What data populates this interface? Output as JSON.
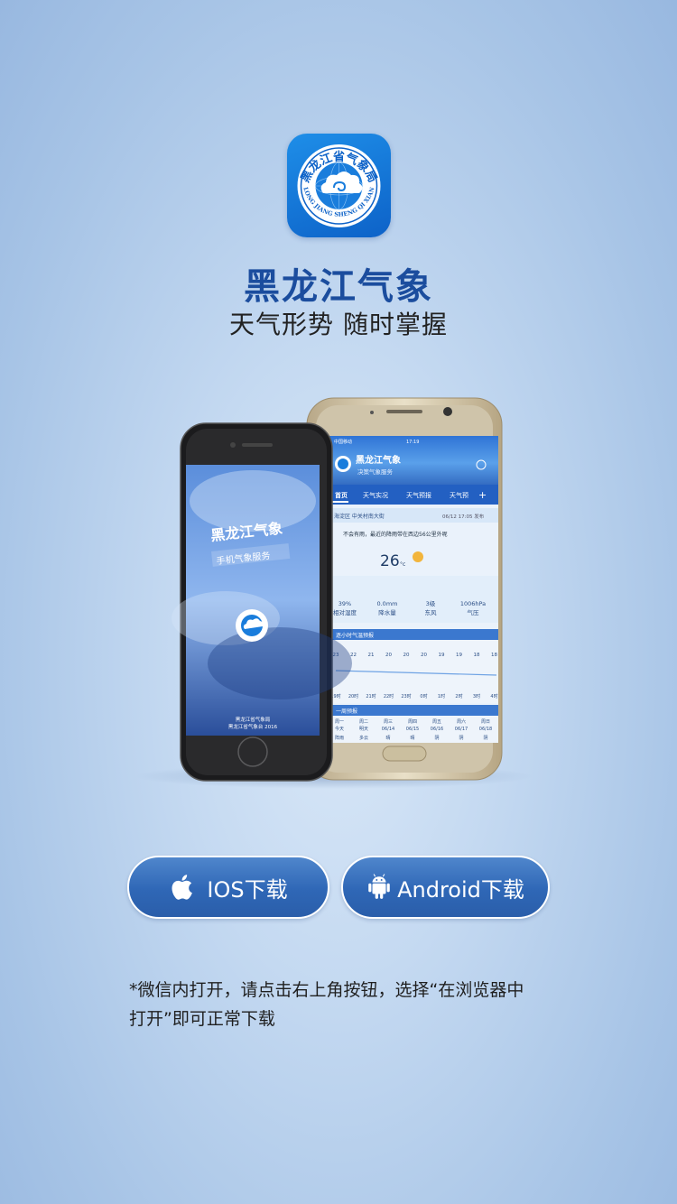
{
  "app": {
    "icon_name": "heilongjiang-weather-bureau-logo",
    "logo_text": "黑龙江省气象局",
    "logo_pinyin": "HEI LONG JIANG SHENG QI XIANG JU",
    "title": "黑龙江气象",
    "tagline": "天气形势 随时掌握"
  },
  "colors": {
    "title": "#1b4d9e",
    "button_bg": "#2f67b6",
    "page_bg": "#c4d9f1"
  },
  "phone_left": {
    "splash_title": "黑龙江气象",
    "splash_subtitle": "手机气象服务",
    "footer_line1": "黑龙江省气象局",
    "footer_line2": "黑龙江省气象台 2016"
  },
  "phone_right": {
    "status_carrier": "中国移动",
    "status_time": "17:19",
    "header_title": "黑龙江气象",
    "header_subtitle": "决策气象服务",
    "tabs": [
      "首页",
      "天气实况",
      "天气预报",
      "天气预"
    ],
    "location": "海淀区 中关村南大街",
    "publish_time": "06/12 17:05 发布",
    "alert": "不会有雨，最近的降雨带在西边56公里外呢",
    "temperature": "26",
    "temperature_unit": "°c",
    "stats": [
      {
        "value": "39%",
        "label": "相对湿度"
      },
      {
        "value": "0.0mm",
        "label": "降水量"
      },
      {
        "value": "3级",
        "label": "东风"
      },
      {
        "value": "1006hPa",
        "label": "气压"
      }
    ],
    "hourly_title": "逐小时气温预报",
    "hourly_temps": [
      "23",
      "22",
      "21",
      "20",
      "20",
      "20",
      "19",
      "19",
      "18",
      "18"
    ],
    "hourly_times": [
      "19时",
      "20时",
      "21时",
      "22时",
      "23时",
      "0时",
      "1时",
      "2时",
      "3时",
      "4时"
    ],
    "weekly_title": "一周预报",
    "weekly_days": [
      "周一",
      "周二",
      "周三",
      "周四",
      "周五",
      "周六",
      "周日"
    ],
    "weekly_dates": [
      "今天",
      "明天",
      "06/14",
      "06/15",
      "06/16",
      "06/17",
      "06/18"
    ],
    "weekly_weather": [
      "阵雨",
      "多云",
      "晴",
      "晴",
      "阴",
      "阴",
      "阴"
    ]
  },
  "buttons": {
    "ios": {
      "label": "IOS下载",
      "icon": "apple-icon"
    },
    "android": {
      "label": "Android下载",
      "icon": "android-icon"
    }
  },
  "note": {
    "line1": "*微信内打开，请点击右上角按钮，选择“在浏览器中",
    "line2": "打开”即可正常下载"
  }
}
